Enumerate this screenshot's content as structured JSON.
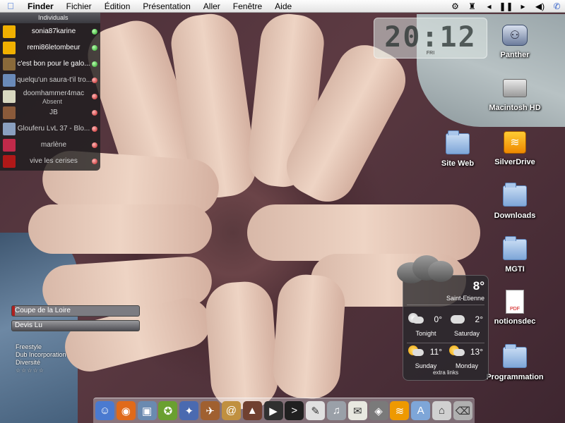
{
  "menubar": {
    "apple_icon": "apple-icon",
    "items": [
      "Finder",
      "Fichier",
      "Édition",
      "Présentation",
      "Aller",
      "Fenêtre",
      "Aide"
    ],
    "right_icons": [
      "gear-icon",
      "spy-icon",
      "previous-track-icon",
      "pause-icon",
      "next-track-icon",
      "volume-icon",
      "phone-icon"
    ]
  },
  "buddylist": {
    "group_label": "Individuals",
    "buddies": [
      {
        "name": "sonia87karine",
        "status": "online",
        "avatar_color": "#f0b000"
      },
      {
        "name": "remi86letombeur",
        "status": "online",
        "avatar_color": "#f0b000"
      },
      {
        "name": "c'est bon pour le galo...",
        "status": "online",
        "avatar_color": "#8a6a3a"
      },
      {
        "name": "quelqu'un saura-t'il tro...",
        "status": "away",
        "avatar_color": "#6a8ab8"
      },
      {
        "name": "doomhammer4mac",
        "sub": "Absent",
        "status": "away",
        "avatar_color": "#d8d8c0"
      },
      {
        "name": "JB",
        "status": "away",
        "avatar_color": "#8a5a3a"
      },
      {
        "name": "Glouferu LvL 37 - Blo...",
        "status": "away",
        "avatar_color": "#8aa0c0"
      },
      {
        "name": "marlène",
        "status": "away",
        "avatar_color": "#c02a4a"
      },
      {
        "name": "vive les cerises",
        "status": "away",
        "avatar_color": "#b01818"
      }
    ]
  },
  "clock": {
    "time": "20:12",
    "day": "FRI"
  },
  "desktop_icons": [
    {
      "label": "Panther",
      "icon": "panther-icon"
    },
    {
      "label": "Macintosh HD",
      "icon": "hard-drive-icon"
    },
    {
      "label": "Site Web",
      "icon": "folder-icon"
    },
    {
      "label": "SilverDrive",
      "icon": "silverdrive-icon"
    },
    {
      "label": "Downloads",
      "icon": "folder-icon"
    },
    {
      "label": "MGTI",
      "icon": "folder-icon"
    },
    {
      "label": "notionsdec",
      "icon": "pdf-icon",
      "badge": "PDF"
    },
    {
      "label": "Programmation",
      "icon": "folder-icon"
    }
  ],
  "music": {
    "tracks": [
      "Coupe de la Loire",
      "Devis Lu"
    ],
    "genre": "Freestyle",
    "artist": "Dub Incorporation",
    "album": "Diversité",
    "rating": "☆☆☆☆☆"
  },
  "weather": {
    "current_temp": "8°",
    "city": "Saint-Etienne",
    "forecast": [
      {
        "day": "Tonight",
        "temp": "0°",
        "icon": "moon-icon"
      },
      {
        "day": "Saturday",
        "temp": "2°",
        "icon": "cloud-icon"
      },
      {
        "day": "Sunday",
        "temp": "11°",
        "icon": "partly-sunny-icon"
      },
      {
        "day": "Monday",
        "temp": "13°",
        "icon": "partly-sunny-icon"
      }
    ],
    "links_label": "extra links"
  },
  "dock": {
    "items": [
      {
        "name": "finder-icon",
        "color": "#4a7ad0",
        "glyph": "☺"
      },
      {
        "name": "firefox-icon",
        "color": "#e06a1a",
        "glyph": "◉"
      },
      {
        "name": "preview-icon",
        "color": "#6a8ab0",
        "glyph": "▣"
      },
      {
        "name": "adium-icon",
        "color": "#6aa030",
        "glyph": "✪"
      },
      {
        "name": "safari-icon",
        "color": "#4a6ab0",
        "glyph": "✦"
      },
      {
        "name": "game-icon",
        "color": "#a06030",
        "glyph": "✈"
      },
      {
        "name": "address-book-icon",
        "color": "#c09040",
        "glyph": "@"
      },
      {
        "name": "photo-icon",
        "color": "#704030",
        "glyph": "▲"
      },
      {
        "name": "dvd-player-icon",
        "color": "#303030",
        "glyph": "▶"
      },
      {
        "name": "terminal-icon",
        "color": "#202020",
        "glyph": ">"
      },
      {
        "name": "textedit-icon",
        "color": "#e0e0e0",
        "glyph": "✎"
      },
      {
        "name": "itunes-icon",
        "color": "#9aa0a8",
        "glyph": "♫"
      },
      {
        "name": "notes-icon",
        "color": "#e8e8e0",
        "glyph": "✉"
      },
      {
        "name": "utility-icon",
        "color": "#7a7a7a",
        "glyph": "◈"
      },
      {
        "name": "silverdrive-dock-icon",
        "color": "#ee9900",
        "glyph": "≋"
      },
      {
        "name": "applications-folder-icon",
        "color": "#7ea6d8",
        "glyph": "A"
      },
      {
        "name": "home-folder-icon",
        "color": "#d0d0d0",
        "glyph": "⌂"
      },
      {
        "name": "trash-icon",
        "color": "#b0b0b0",
        "glyph": "⌫"
      }
    ]
  }
}
